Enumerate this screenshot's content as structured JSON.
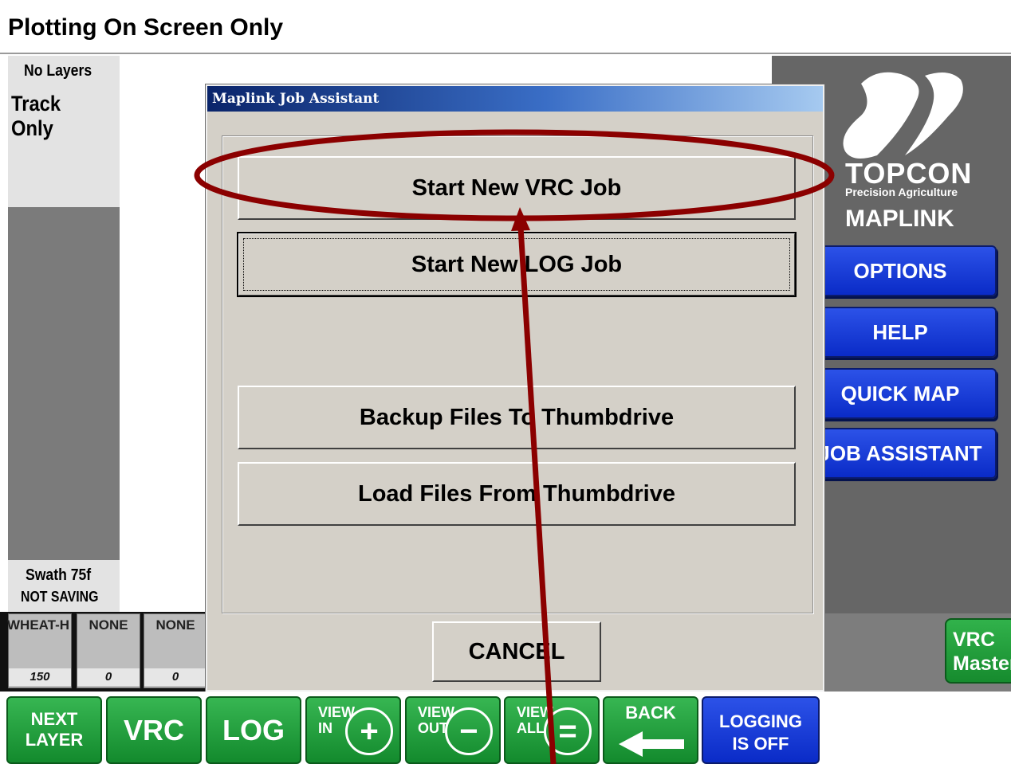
{
  "title_bar": {
    "text": "Plotting On Screen Only"
  },
  "left_panel": {
    "layers_label": "No Layers",
    "mode": "Track Only",
    "swath": "Swath 75f",
    "saving_status": "NOT SAVING"
  },
  "layers": [
    {
      "name": "WHEAT-HR",
      "value": "150"
    },
    {
      "name": "NONE",
      "value": "0"
    },
    {
      "name": "NONE",
      "value": "0"
    }
  ],
  "brand": {
    "logo_word": "TOPCON",
    "logo_sub": "Precision Agriculture",
    "product": "MAPLINK"
  },
  "side_buttons": {
    "options": "OPTIONS",
    "help": "HELP",
    "quick_map": "QUICK MAP",
    "job_assistant": "JOB ASSISTANT"
  },
  "vrc_master": {
    "line1": "VRC",
    "line2": "Master"
  },
  "dialog": {
    "title": "Maplink Job Assistant",
    "start_vrc": "Start New VRC Job",
    "start_log": "Start New LOG Job",
    "backup": "Backup Files To Thumbdrive",
    "load": "Load Files From Thumbdrive",
    "cancel": "CANCEL"
  },
  "bottom_buttons": {
    "next_layer_1": "NEXT",
    "next_layer_2": "LAYER",
    "vrc": "VRC",
    "log": "LOG",
    "view_in_1": "VIEW",
    "view_in_2": "IN",
    "view_out_1": "VIEW",
    "view_out_2": "OUT",
    "view_all_1": "VIEW",
    "view_all_2": "ALL",
    "back": "BACK",
    "logging_1": "LOGGING",
    "logging_2": "IS OFF"
  },
  "colors": {
    "annotation": "#8b0000",
    "green_button": "#1f9a3a",
    "blue_button": "#1a3fd8",
    "dialog_bg": "#d4d0c8"
  }
}
